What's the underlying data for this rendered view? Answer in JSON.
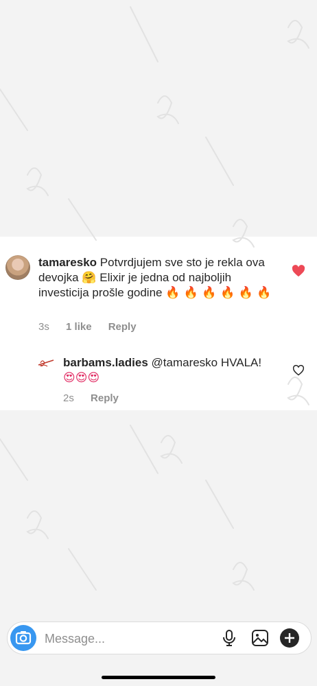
{
  "comments": [
    {
      "username": "tamaresko",
      "text_a": "Potvrdjujem sve sto je rekla ova devojka",
      "emoji_a": "🤗",
      "text_b": "Elixir je jedna od najboljih investicija prošle godine",
      "emoji_b": "🔥 🔥 🔥 🔥 🔥 🔥",
      "time": "3s",
      "likes": "1 like",
      "reply": "Reply",
      "liked": true,
      "like_color": "#ed4956"
    },
    {
      "username": "barbams.ladies",
      "mention": "@tamaresko",
      "text": "HVALA!",
      "emoji": "😍😍😍",
      "time": "2s",
      "reply": "Reply",
      "liked": false
    }
  ],
  "composer": {
    "placeholder": "Message...",
    "accent_color": "#3897f0",
    "icons": [
      "camera-icon",
      "microphone-icon",
      "gallery-icon",
      "plus-icon"
    ]
  }
}
